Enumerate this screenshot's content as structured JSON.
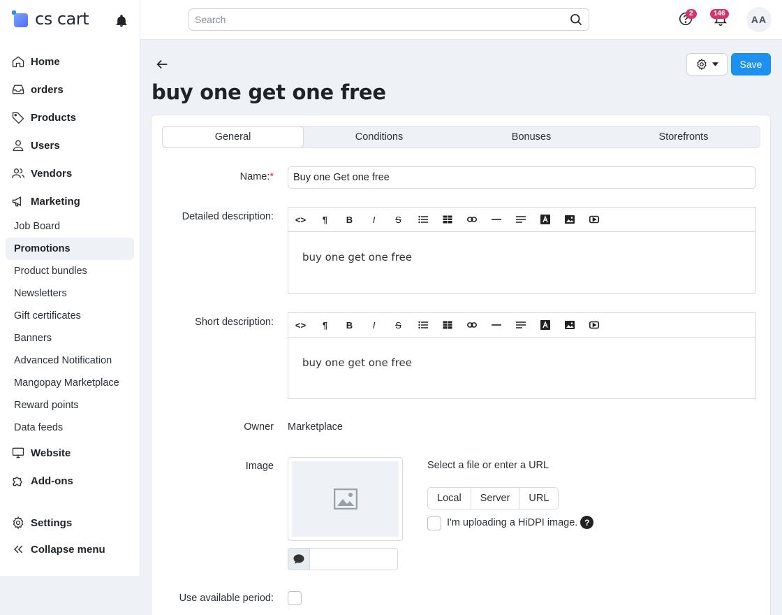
{
  "brand": {
    "name": "cs cart"
  },
  "sidebar": {
    "items": [
      {
        "label": "Home",
        "icon": "home-icon"
      },
      {
        "label": "orders",
        "icon": "inbox-icon"
      },
      {
        "label": "Products",
        "icon": "tag-icon"
      },
      {
        "label": "Users",
        "icon": "user-icon"
      },
      {
        "label": "Vendors",
        "icon": "users-icon"
      },
      {
        "label": "Marketing",
        "icon": "megaphone-icon"
      }
    ],
    "marketing_sub": [
      "Job Board",
      "Promotions",
      "Product bundles",
      "Newsletters",
      "Gift certificates",
      "Banners",
      "Advanced Notification",
      "Mangopay Marketplace",
      "Reward points",
      "Data feeds"
    ],
    "active_sub": "Promotions",
    "website": "Website",
    "addons": "Add-ons",
    "settings": "Settings",
    "collapse": "Collapse menu"
  },
  "topbar": {
    "search_placeholder": "Search",
    "help_badge": "2",
    "notif_badge": "146",
    "avatar_initials": "AA"
  },
  "page": {
    "title": "buy one get one free",
    "save_label": "Save"
  },
  "tabs": [
    "General",
    "Conditions",
    "Bonuses",
    "Storefronts"
  ],
  "active_tab": "General",
  "form": {
    "name_label": "Name:",
    "name_required": "*",
    "name_value": "Buy one Get one free",
    "detailed_label": "Detailed description:",
    "detailed_value": "buy one get one free",
    "short_label": "Short description:",
    "short_value": "buy one get one free",
    "owner_label": "Owner",
    "owner_value": "Marketplace",
    "image_label": "Image",
    "select_file_text": "Select a file or enter a URL",
    "upload_sources": [
      "Local",
      "Server",
      "URL"
    ],
    "hidpi_label": "I'm uploading a HiDPI image.",
    "hidpi_help": "?",
    "period_label": "Use available period:"
  },
  "colors": {
    "accent": "#1c91f0",
    "badge": "#d6336c",
    "background": "#eef1f6"
  }
}
